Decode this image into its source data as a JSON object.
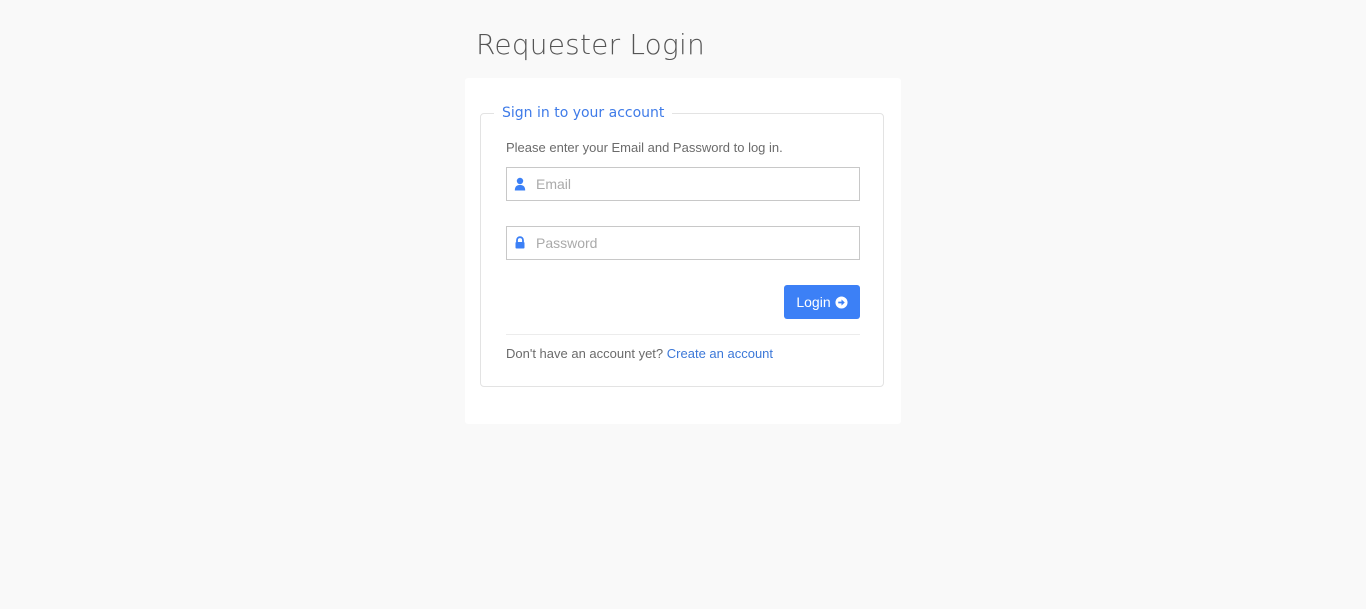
{
  "page": {
    "title": "Requester Login"
  },
  "login_form": {
    "legend": "Sign in to your account",
    "instructions": "Please enter your Email and Password to log in.",
    "email": {
      "placeholder": "Email",
      "value": "",
      "icon": "user-icon"
    },
    "password": {
      "placeholder": "Password",
      "value": "",
      "icon": "lock-icon"
    },
    "login_label": "Login",
    "login_icon": "arrow-circle-right-icon",
    "signup_prompt": "Don't have an account yet?",
    "signup_link": "Create an account"
  },
  "colors": {
    "accent": "#3c80f6",
    "legend": "#3f7be8",
    "background": "#f9f9f9"
  }
}
